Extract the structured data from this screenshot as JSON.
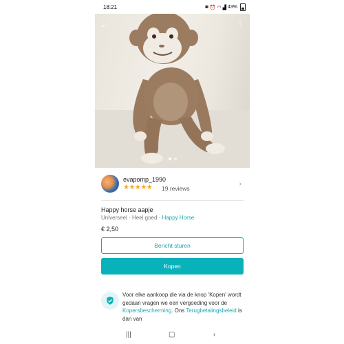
{
  "status_bar": {
    "time": "18:21",
    "battery": "43%"
  },
  "photo": {
    "image_label": "plush monkey photo",
    "page_dots": 2,
    "active_dot": 0
  },
  "seller": {
    "name": "evapomp_1990",
    "rating": 4.5,
    "stars": "★★★★★",
    "reviews": "19 reviews"
  },
  "item": {
    "title": "Happy horse aapje",
    "size": "Universeel",
    "separator": "·",
    "condition": "Heel goed",
    "brand": "Happy Horse",
    "price": "€ 2,50"
  },
  "actions": {
    "message_label": "Bericht sturen",
    "buy_label": "Kopen"
  },
  "protection": {
    "text_1": "Voor elke aankoop die via de knop 'Kopen' wordt gedaan vragen we een vergoeding voor de ",
    "link_1": "Kopersbescherming",
    "text_2": ". Ons ",
    "link_2": "Terugbetalingsbeleid",
    "text_3": " is dan van"
  },
  "colors": {
    "accent": "#09b1ba",
    "star": "#f5a623"
  },
  "icons": {
    "back": "arrow-left-icon",
    "more": "more-vertical-icon",
    "shield": "shield-check-icon",
    "chevron": "chevron-right-icon"
  }
}
